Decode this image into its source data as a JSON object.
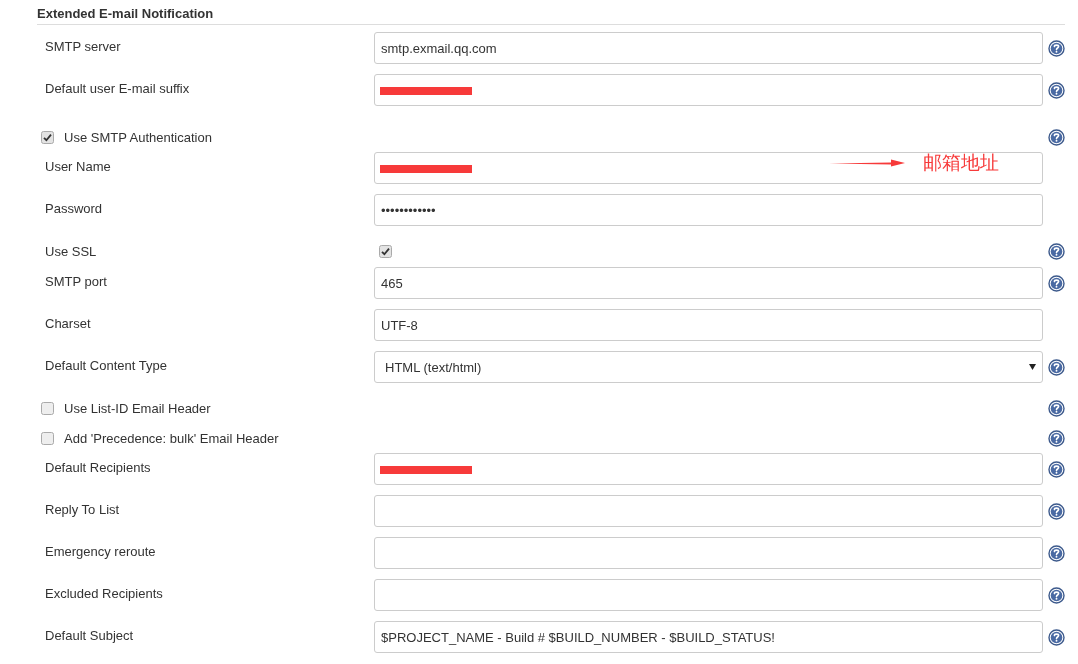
{
  "section": {
    "title": "Extended E-mail Notification"
  },
  "rows": [
    {
      "kind": "field",
      "label": "SMTP server",
      "value": "smtp.exmail.qq.com",
      "redacted": false,
      "help": true
    },
    {
      "kind": "field",
      "label": "Default user E-mail suffix",
      "redacted": true,
      "help": true
    },
    {
      "kind": "checkbox",
      "label": "Use SMTP Authentication",
      "checked": true,
      "help": true
    },
    {
      "kind": "field",
      "label": "User Name",
      "redacted": true,
      "help": false,
      "annotation": "邮箱地址"
    },
    {
      "kind": "field",
      "label": "Password",
      "value": "••••••••••••",
      "redacted": false,
      "help": false
    },
    {
      "kind": "inline-checkbox",
      "label": "Use SSL",
      "checked": true,
      "help": true
    },
    {
      "kind": "field",
      "label": "SMTP port",
      "value": "465",
      "redacted": false,
      "help": true
    },
    {
      "kind": "field",
      "label": "Charset",
      "value": "UTF-8",
      "redacted": false,
      "help": false
    },
    {
      "kind": "select",
      "label": "Default Content Type",
      "value": "HTML (text/html)",
      "help": true
    },
    {
      "kind": "checkbox",
      "label": "Use List-ID Email Header",
      "checked": false,
      "help": true
    },
    {
      "kind": "checkbox",
      "label": "Add 'Precedence: bulk' Email Header",
      "checked": false,
      "help": true
    },
    {
      "kind": "field",
      "label": "Default Recipients",
      "redacted": true,
      "help": true
    },
    {
      "kind": "field",
      "label": "Reply To List",
      "redacted": false,
      "help": true
    },
    {
      "kind": "field",
      "label": "Emergency reroute",
      "redacted": false,
      "help": true
    },
    {
      "kind": "field",
      "label": "Excluded Recipients",
      "redacted": false,
      "help": true
    },
    {
      "kind": "field",
      "label": "Default Subject",
      "value": "$PROJECT_NAME - Build # $BUILD_NUMBER - $BUILD_STATUS!",
      "redacted": false,
      "help": true
    }
  ]
}
